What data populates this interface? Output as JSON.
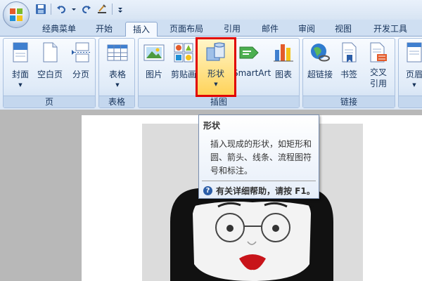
{
  "tabs": [
    "经典菜单",
    "开始",
    "插入",
    "页面布局",
    "引用",
    "邮件",
    "审阅",
    "视图",
    "开发工具"
  ],
  "active_tab": "插入",
  "groups": {
    "page": {
      "label": "页",
      "buttons": [
        "封面",
        "空白页",
        "分页"
      ]
    },
    "table": {
      "label": "表格",
      "buttons": [
        "表格"
      ]
    },
    "illustration": {
      "label": "插图",
      "buttons": [
        "图片",
        "剪贴画",
        "形状",
        "SmartArt",
        "图表"
      ]
    },
    "links": {
      "label": "链接",
      "buttons": [
        "超链接",
        "书签",
        "交叉",
        "引用"
      ]
    },
    "header": {
      "buttons": [
        "页眉"
      ]
    }
  },
  "tooltip": {
    "title": "形状",
    "lines": [
      "插入现成的形状，如矩形和",
      "圆、箭头、线条、流程图符",
      "号和标注。"
    ],
    "help": "有关详细帮助，请按 F1。",
    "help_icon": "?"
  },
  "colors": {
    "highlight": "#e00000",
    "accent": "#2c5ea8"
  },
  "icons": [
    "office-logo-icon",
    "save-icon",
    "undo-icon",
    "redo-icon",
    "format-painter-icon",
    "qat-dropdown-icon"
  ]
}
